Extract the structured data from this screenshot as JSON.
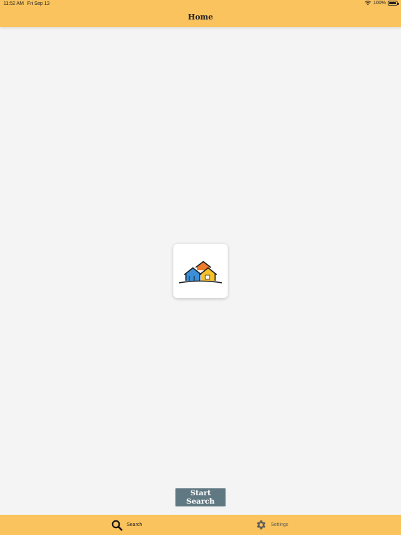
{
  "status_bar": {
    "time": "11:52 AM",
    "date": "Fri Sep 13",
    "battery": "100%"
  },
  "nav": {
    "title": "Home"
  },
  "main": {
    "logo_icon": "houses-logo-icon",
    "start_button_label": "Start Search"
  },
  "tab_bar": {
    "tabs": [
      {
        "label": "Search",
        "icon": "search-icon",
        "selected": true
      },
      {
        "label": "Settings",
        "icon": "gear-icon",
        "selected": false
      }
    ]
  },
  "colors": {
    "header_bg": "#fbc35d",
    "page_bg": "#f4f4f4",
    "button_bg": "#607882",
    "house_blue": "#3a8fd6",
    "house_orange": "#ee7a2d",
    "house_yellow": "#f7c12c"
  }
}
